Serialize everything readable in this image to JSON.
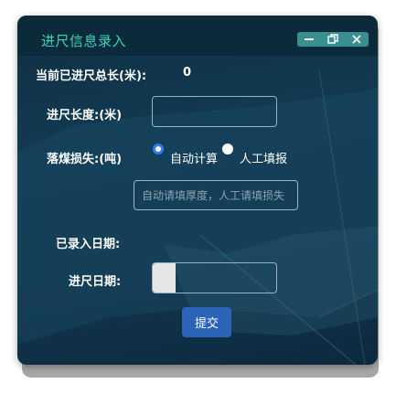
{
  "window": {
    "title": "进尺信息录入",
    "buttons": [
      "minimize-icon",
      "restore-icon",
      "close-icon"
    ]
  },
  "form": {
    "total_label": "当前已进尺总长(米):",
    "total_value": "0",
    "length_label": "进尺长度:(米)",
    "length_value": "",
    "loss_label": "落煤损失:(吨)",
    "loss_options": [
      {
        "label": "自动计算",
        "selected": true
      },
      {
        "label": "人工填报",
        "selected": false
      }
    ],
    "loss_placeholder": "自动请填厚度，人工请填损失",
    "recorded_dates_label": "已录入日期:",
    "date_label": "进尺日期:",
    "date_value": "",
    "submit_label": "提交"
  },
  "colors": {
    "title": "#36d3c0",
    "accent_button": "#2a63b8",
    "window_buttons": "#3a8f90",
    "radio_selected": "#2f7bf0"
  }
}
